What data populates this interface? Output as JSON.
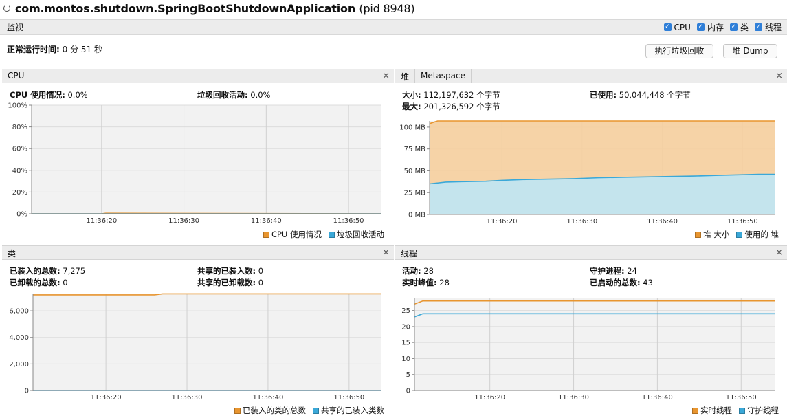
{
  "app": {
    "title": "com.montos.shutdown.SpringBootShutdownApplication",
    "pid": "(pid 8948)"
  },
  "tab": {
    "monitor": "监视"
  },
  "toggles": [
    "CPU",
    "内存",
    "类",
    "线程"
  ],
  "uptime": {
    "label": "正常运行时间:",
    "value": "0 分 51 秒"
  },
  "buttons": {
    "gc": "执行垃圾回收",
    "dump": "堆 Dump"
  },
  "close_glyph": "×",
  "colors": {
    "orange": "#e8952f",
    "blue": "#3aa8d8",
    "orange_fill": "#f6cf9e",
    "blue_fill": "#bfe6f5"
  },
  "cpu": {
    "title": "CPU",
    "usage_label": "CPU 使用情况:",
    "usage_value": "0.0%",
    "gc_label": "垃圾回收活动:",
    "gc_value": "0.0%",
    "legend": [
      "CPU 使用情况",
      "垃圾回收活动"
    ]
  },
  "heap": {
    "tabs": [
      "堆",
      "Metaspace"
    ],
    "size_label": "大小:",
    "size_value": "112,197,632 个字节",
    "max_label": "最大:",
    "max_value": "201,326,592 个字节",
    "used_label": "已使用:",
    "used_value": "50,044,448 个字节",
    "legend": [
      "堆 大小",
      "使用的 堆"
    ]
  },
  "classes": {
    "title": "类",
    "loaded_label": "已装入的总数:",
    "loaded_value": "7,275",
    "unloaded_label": "已卸载的总数:",
    "unloaded_value": "0",
    "shared_loaded_label": "共享的已装入数:",
    "shared_loaded_value": "0",
    "shared_unloaded_label": "共享的已卸载数:",
    "shared_unloaded_value": "0",
    "legend": [
      "已装入的类的总数",
      "共享的已装入类数"
    ]
  },
  "threads": {
    "title": "线程",
    "live_label": "活动:",
    "live_value": "28",
    "peak_label": "实时峰值:",
    "peak_value": "28",
    "daemon_label": "守护进程:",
    "daemon_value": "24",
    "started_label": "已启动的总数:",
    "started_value": "43",
    "legend": [
      "实时线程",
      "守护线程"
    ]
  },
  "chart_data": [
    {
      "id": "cpu",
      "type": "line",
      "x_ticks": [
        "11:36:20",
        "11:36:30",
        "11:36:40",
        "11:36:50"
      ],
      "y_ticks": [
        "0%",
        "20%",
        "40%",
        "60%",
        "80%",
        "100%"
      ],
      "ylim": [
        0,
        100
      ],
      "xlim": [
        11.5,
        54
      ],
      "series": [
        {
          "name": "CPU 使用情况",
          "color": "#e8952f",
          "x": [
            11.5,
            20,
            20.5,
            54
          ],
          "y": [
            0,
            0,
            0.5,
            0
          ]
        },
        {
          "name": "垃圾回收活动",
          "color": "#3aa8d8",
          "x": [
            11.5,
            54
          ],
          "y": [
            0,
            0
          ]
        }
      ]
    },
    {
      "id": "heap",
      "type": "area",
      "x_ticks": [
        "11:36:20",
        "11:36:30",
        "11:36:40",
        "11:36:50"
      ],
      "y_ticks": [
        "0 MB",
        "25 MB",
        "50 MB",
        "75 MB",
        "100 MB"
      ],
      "ylim": [
        0,
        107
      ],
      "xlim": [
        11,
        54
      ],
      "series": [
        {
          "name": "堆 大小",
          "color": "#e8952f",
          "fill": "#f6cf9e",
          "x": [
            11,
            12,
            54
          ],
          "y": [
            104,
            107,
            107
          ]
        },
        {
          "name": "使用的 堆",
          "color": "#3aa8d8",
          "fill": "#bfe6f5",
          "x": [
            11,
            12,
            13,
            15,
            18,
            20,
            23,
            26,
            29,
            32,
            35,
            38,
            41,
            44,
            47,
            50,
            52,
            54
          ],
          "y": [
            35,
            36,
            37,
            37.5,
            38,
            39,
            40,
            40.5,
            41,
            42,
            42.5,
            43,
            43.5,
            44,
            44.8,
            45.5,
            46,
            46
          ]
        }
      ]
    },
    {
      "id": "classes",
      "type": "line",
      "x_ticks": [
        "11:36:20",
        "11:36:30",
        "11:36:40",
        "11:36:50"
      ],
      "y_ticks": [
        "0",
        "2,000",
        "4,000",
        "6,000"
      ],
      "ylim": [
        0,
        7300
      ],
      "xlim": [
        11,
        54
      ],
      "series": [
        {
          "name": "已装入的类的总数",
          "color": "#e8952f",
          "x": [
            11,
            26,
            27,
            54
          ],
          "y": [
            7200,
            7200,
            7275,
            7275
          ]
        },
        {
          "name": "共享的已装入类数",
          "color": "#3aa8d8",
          "x": [
            11,
            54
          ],
          "y": [
            0,
            0
          ]
        }
      ]
    },
    {
      "id": "threads",
      "type": "line",
      "x_ticks": [
        "11:36:20",
        "11:36:30",
        "11:36:40",
        "11:36:50"
      ],
      "y_ticks": [
        "0",
        "5",
        "10",
        "15",
        "20",
        "25"
      ],
      "ylim": [
        0,
        29
      ],
      "xlim": [
        11,
        54
      ],
      "series": [
        {
          "name": "实时线程",
          "color": "#e8952f",
          "x": [
            11,
            12,
            54
          ],
          "y": [
            27,
            28,
            28
          ]
        },
        {
          "name": "守护线程",
          "color": "#3aa8d8",
          "x": [
            11,
            12,
            54
          ],
          "y": [
            23,
            24,
            24
          ]
        }
      ]
    }
  ]
}
